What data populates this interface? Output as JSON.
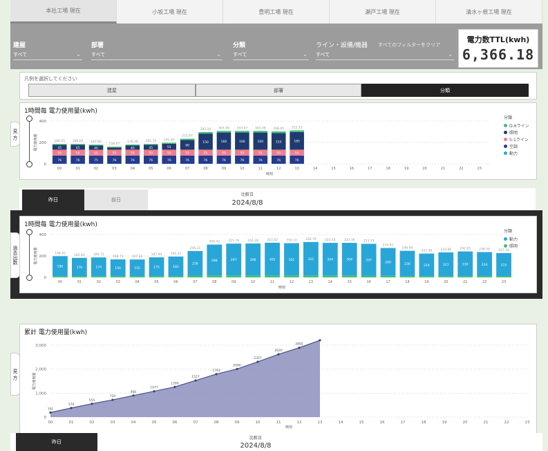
{
  "tabs": [
    {
      "label": "本社工場 現在",
      "active": true
    },
    {
      "label": "小坂工場 現在",
      "active": false
    },
    {
      "label": "豊明工場 現在",
      "active": false
    },
    {
      "label": "瀬戸工場 現在",
      "active": false
    },
    {
      "label": "清水ヶ根工場 現在",
      "active": false
    }
  ],
  "filters": {
    "items": [
      {
        "label": "建屋",
        "value": "すべて"
      },
      {
        "label": "部署",
        "value": "すべて"
      },
      {
        "label": "分類",
        "value": "すべて"
      },
      {
        "label": "ライン・設備/機器",
        "value": "すべて"
      }
    ],
    "clear_label": "すべてのフィルターをクリア"
  },
  "ttl": {
    "title": "電力数TTL(kwh)",
    "value": "6,366.18"
  },
  "selector": {
    "title": "凡例を選択してください",
    "options": [
      {
        "label": "建屋",
        "active": false
      },
      {
        "label": "部署",
        "active": false
      },
      {
        "label": "分類",
        "active": true
      }
    ]
  },
  "panel1": {
    "title": "1時間毎 電力使用量(kwh)",
    "side_tab": "見 方"
  },
  "panel2": {
    "title": "1時間毎 電力使用量(kwh)",
    "side_tab": "過去出数"
  },
  "panel3": {
    "title": "累計 電力使用量(kwh)",
    "side_tab": "見 方"
  },
  "datebar1": {
    "btn_today": "昨日",
    "btn_other": "前日",
    "caption": "比較日",
    "date": "2024/8/8"
  },
  "datebar3": {
    "btn_today": "昨日",
    "caption": "比較日",
    "date": "2024/8/8"
  },
  "colors": {
    "s1": "#29a6d8",
    "s2": "#243a8c",
    "s3": "#f07d8e",
    "s4": "#3fbf73",
    "s5": "#1f3a70",
    "area": "#8c91be",
    "dark": "#2a2a2a"
  },
  "chart_data": [
    {
      "type": "bar",
      "title": "1時間毎 電力使用量(kwh)",
      "xlabel": "時刻",
      "ylabel": "電力使用量",
      "ylim": [
        0,
        400
      ],
      "yticks": [
        0,
        200,
        400
      ],
      "categories": [
        "00",
        "01",
        "02",
        "03",
        "04",
        "05",
        "06",
        "07",
        "08",
        "09",
        "10",
        "11",
        "12",
        "13",
        "14",
        "15",
        "16",
        "17",
        "18",
        "19",
        "20",
        "21",
        "22",
        "23"
      ],
      "legend_title": "分類",
      "series": [
        {
          "name": "動力",
          "color": "#29a6d8",
          "values": [
            2,
            2,
            2,
            2,
            2,
            2,
            2,
            2,
            2,
            2,
            2,
            2,
            2,
            2
          ]
        },
        {
          "name": "空調",
          "color": "#243a8c",
          "values": [
            76,
            76,
            75,
            76,
            76,
            76,
            76,
            76,
            76,
            76,
            76,
            76,
            76,
            76
          ]
        },
        {
          "name": "S-1ライン",
          "color": "#f07d8e",
          "values": [
            55,
            55,
            55,
            55,
            55,
            55,
            55,
            55,
            55,
            55,
            55,
            55,
            55,
            55
          ]
        },
        {
          "name": "照明",
          "color": "#1f3a70",
          "values": [
            45,
            45,
            40,
            20,
            40,
            45,
            55,
            90,
            150,
            160,
            160,
            160,
            155,
            165
          ]
        },
        {
          "name": "D-6ライン",
          "color": "#3fbf73",
          "values": [
            8,
            8,
            8,
            8,
            8,
            8,
            10,
            12,
            14,
            15,
            15,
            15,
            15,
            15
          ]
        }
      ],
      "totals": [
        186.65,
        188.65,
        187.6,
        158.07,
        176.39,
        185.76,
        191.4,
        215.67,
        293.24,
        307.99,
        303.07,
        303.08,
        298.65,
        312.33
      ]
    },
    {
      "type": "bar",
      "title": "1時間毎 電力使用量(kwh)",
      "xlabel": "時刻",
      "ylabel": "電力使用量",
      "ylim": [
        0,
        400
      ],
      "yticks": [
        0,
        200,
        400
      ],
      "categories": [
        "00",
        "01",
        "02",
        "03",
        "04",
        "05",
        "06",
        "07",
        "08",
        "09",
        "10",
        "11",
        "12",
        "13",
        "14",
        "15",
        "16",
        "17",
        "18",
        "19",
        "20",
        "21",
        "22",
        "23"
      ],
      "legend_title": "分類",
      "series": [
        {
          "name": "照明",
          "color": "#3fbf73",
          "values": [
            12,
            12,
            12,
            12,
            12,
            12,
            12,
            16,
            18,
            18,
            18,
            18,
            18,
            18,
            18,
            18,
            16,
            14,
            12,
            12,
            12,
            12,
            12,
            12
          ]
        },
        {
          "name": "動力",
          "color": "#29a6d8",
          "values": [
            186,
            170,
            174,
            156,
            155,
            175,
            182,
            230,
            288,
            297,
            298,
            305,
            301,
            312,
            304,
            304,
            297,
            260,
            236,
            210,
            221,
            230,
            224,
            215
          ]
        }
      ],
      "totals": [
        198.45,
        182.6,
        186.72,
        168.73,
        167.82,
        187.94,
        194.31,
        246.31,
        306.42,
        315.78,
        316.28,
        323.42,
        319.1,
        330.79,
        322.4,
        322.36,
        313.73,
        274.91,
        248.4,
        222.49,
        233.86,
        242.65,
        236.59,
        227.34
      ]
    },
    {
      "type": "area",
      "title": "累計 電力使用量(kwh)",
      "xlabel": "時刻",
      "ylabel": "電力使用量",
      "ylim": [
        0,
        3000
      ],
      "yticks": [
        0,
        1000,
        2000,
        3000
      ],
      "categories": [
        "00",
        "01",
        "02",
        "03",
        "04",
        "05",
        "06",
        "07",
        "08",
        "09",
        "10",
        "11",
        "12",
        "13",
        "14",
        "15",
        "16",
        "17",
        "18",
        "19",
        "20",
        "21",
        "22",
        "23"
      ],
      "values": [
        191,
        379,
        555,
        720,
        900,
        1077,
        1260,
        1527,
        1793,
        2006,
        2307,
        2620,
        2892,
        3204
      ],
      "labels": [
        "191",
        "379",
        "555",
        "720",
        "900",
        "1077",
        "1260",
        "1527",
        "1793",
        "2006",
        "2307",
        "2620",
        "2892",
        ""
      ]
    }
  ]
}
